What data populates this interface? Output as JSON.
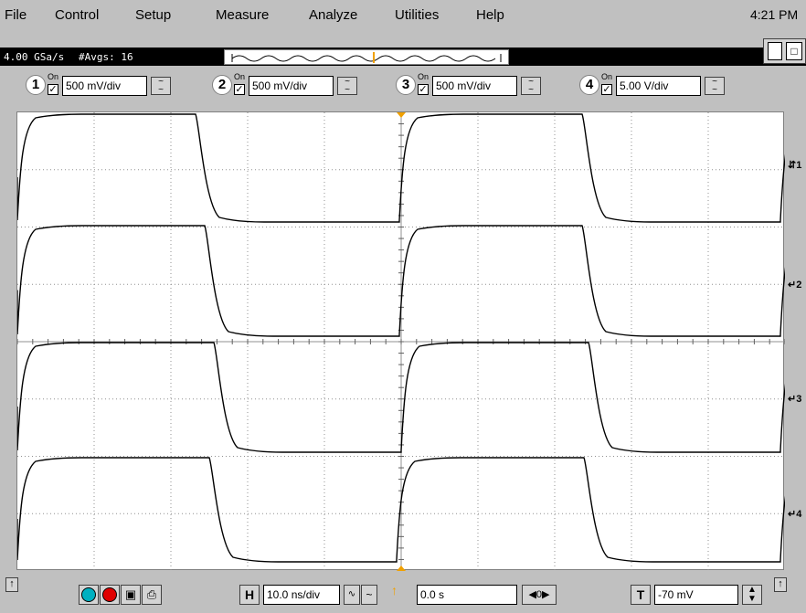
{
  "menu": {
    "items": [
      "File",
      "Control",
      "Setup",
      "Measure",
      "Analyze",
      "Utilities",
      "Help"
    ],
    "underline": [
      "F",
      "C",
      "S",
      "M",
      "A",
      "U",
      "H"
    ],
    "clock": "4:21 PM"
  },
  "acquisition": {
    "sample_rate": "4.00 GSa/s",
    "averages": "#Avgs: 16"
  },
  "channels": [
    {
      "num": "1",
      "on_label": "On",
      "scale": "500 mV/div"
    },
    {
      "num": "2",
      "on_label": "On",
      "scale": "500 mV/div"
    },
    {
      "num": "3",
      "on_label": "On",
      "scale": "500 mV/div"
    },
    {
      "num": "4",
      "on_label": "On",
      "scale": "5.00 V/div"
    }
  ],
  "markers": [
    "1",
    "2",
    "3",
    "4"
  ],
  "timebase": {
    "h_label": "H",
    "scale": "10.0 ns/div",
    "delay": "0.0 s"
  },
  "trigger": {
    "t_label": "T",
    "level": "-70 mV"
  },
  "colors": {
    "trace": "#000000",
    "grid": "#909090",
    "marker_orange": "#f0a000",
    "cyan": "#00b0c0",
    "red": "#e00000"
  }
}
